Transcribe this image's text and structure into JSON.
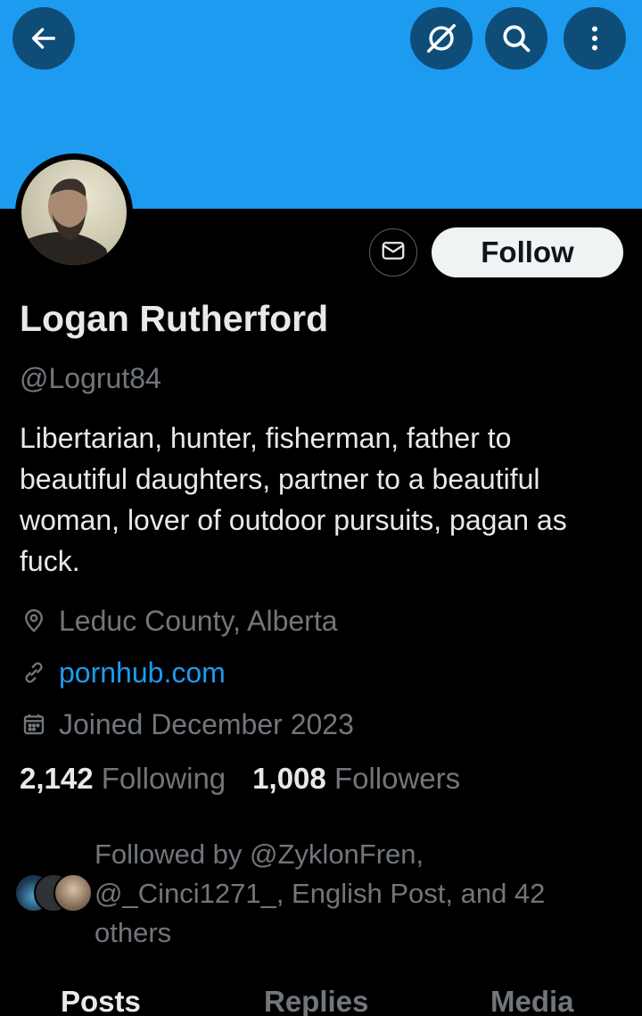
{
  "header": {
    "back_icon": "arrow-left-icon",
    "no_signal_icon": "circle-slash-icon",
    "search_icon": "search-icon",
    "more_icon": "more-vertical-icon",
    "banner_color": "#1d9bf0"
  },
  "profile": {
    "name": "Logan Rutherford",
    "handle": "@Logrut84",
    "bio": "Libertarian, hunter, fisherman, father to beautiful daughters, partner to a beautiful woman, lover of outdoor pursuits, pagan as fuck.",
    "location": "Leduc County, Alberta",
    "website": "pornhub.com",
    "joined": "Joined December 2023"
  },
  "actions": {
    "message_icon": "envelope-icon",
    "follow_label": "Follow"
  },
  "stats": {
    "following_count": "2,142",
    "following_label": "Following",
    "followers_count": "1,008",
    "followers_label": "Followers"
  },
  "followed_by": {
    "text": "Followed by @ZyklonFren, @_Cinci1271_, English Post, and 42 others"
  },
  "tabs": [
    {
      "label": "Posts",
      "active": true
    },
    {
      "label": "Replies",
      "active": false
    },
    {
      "label": "Media",
      "active": false
    }
  ],
  "colors": {
    "accent": "#1d9bf0",
    "text_primary": "#e7e9ea",
    "text_secondary": "#71767b",
    "background": "#000000"
  }
}
